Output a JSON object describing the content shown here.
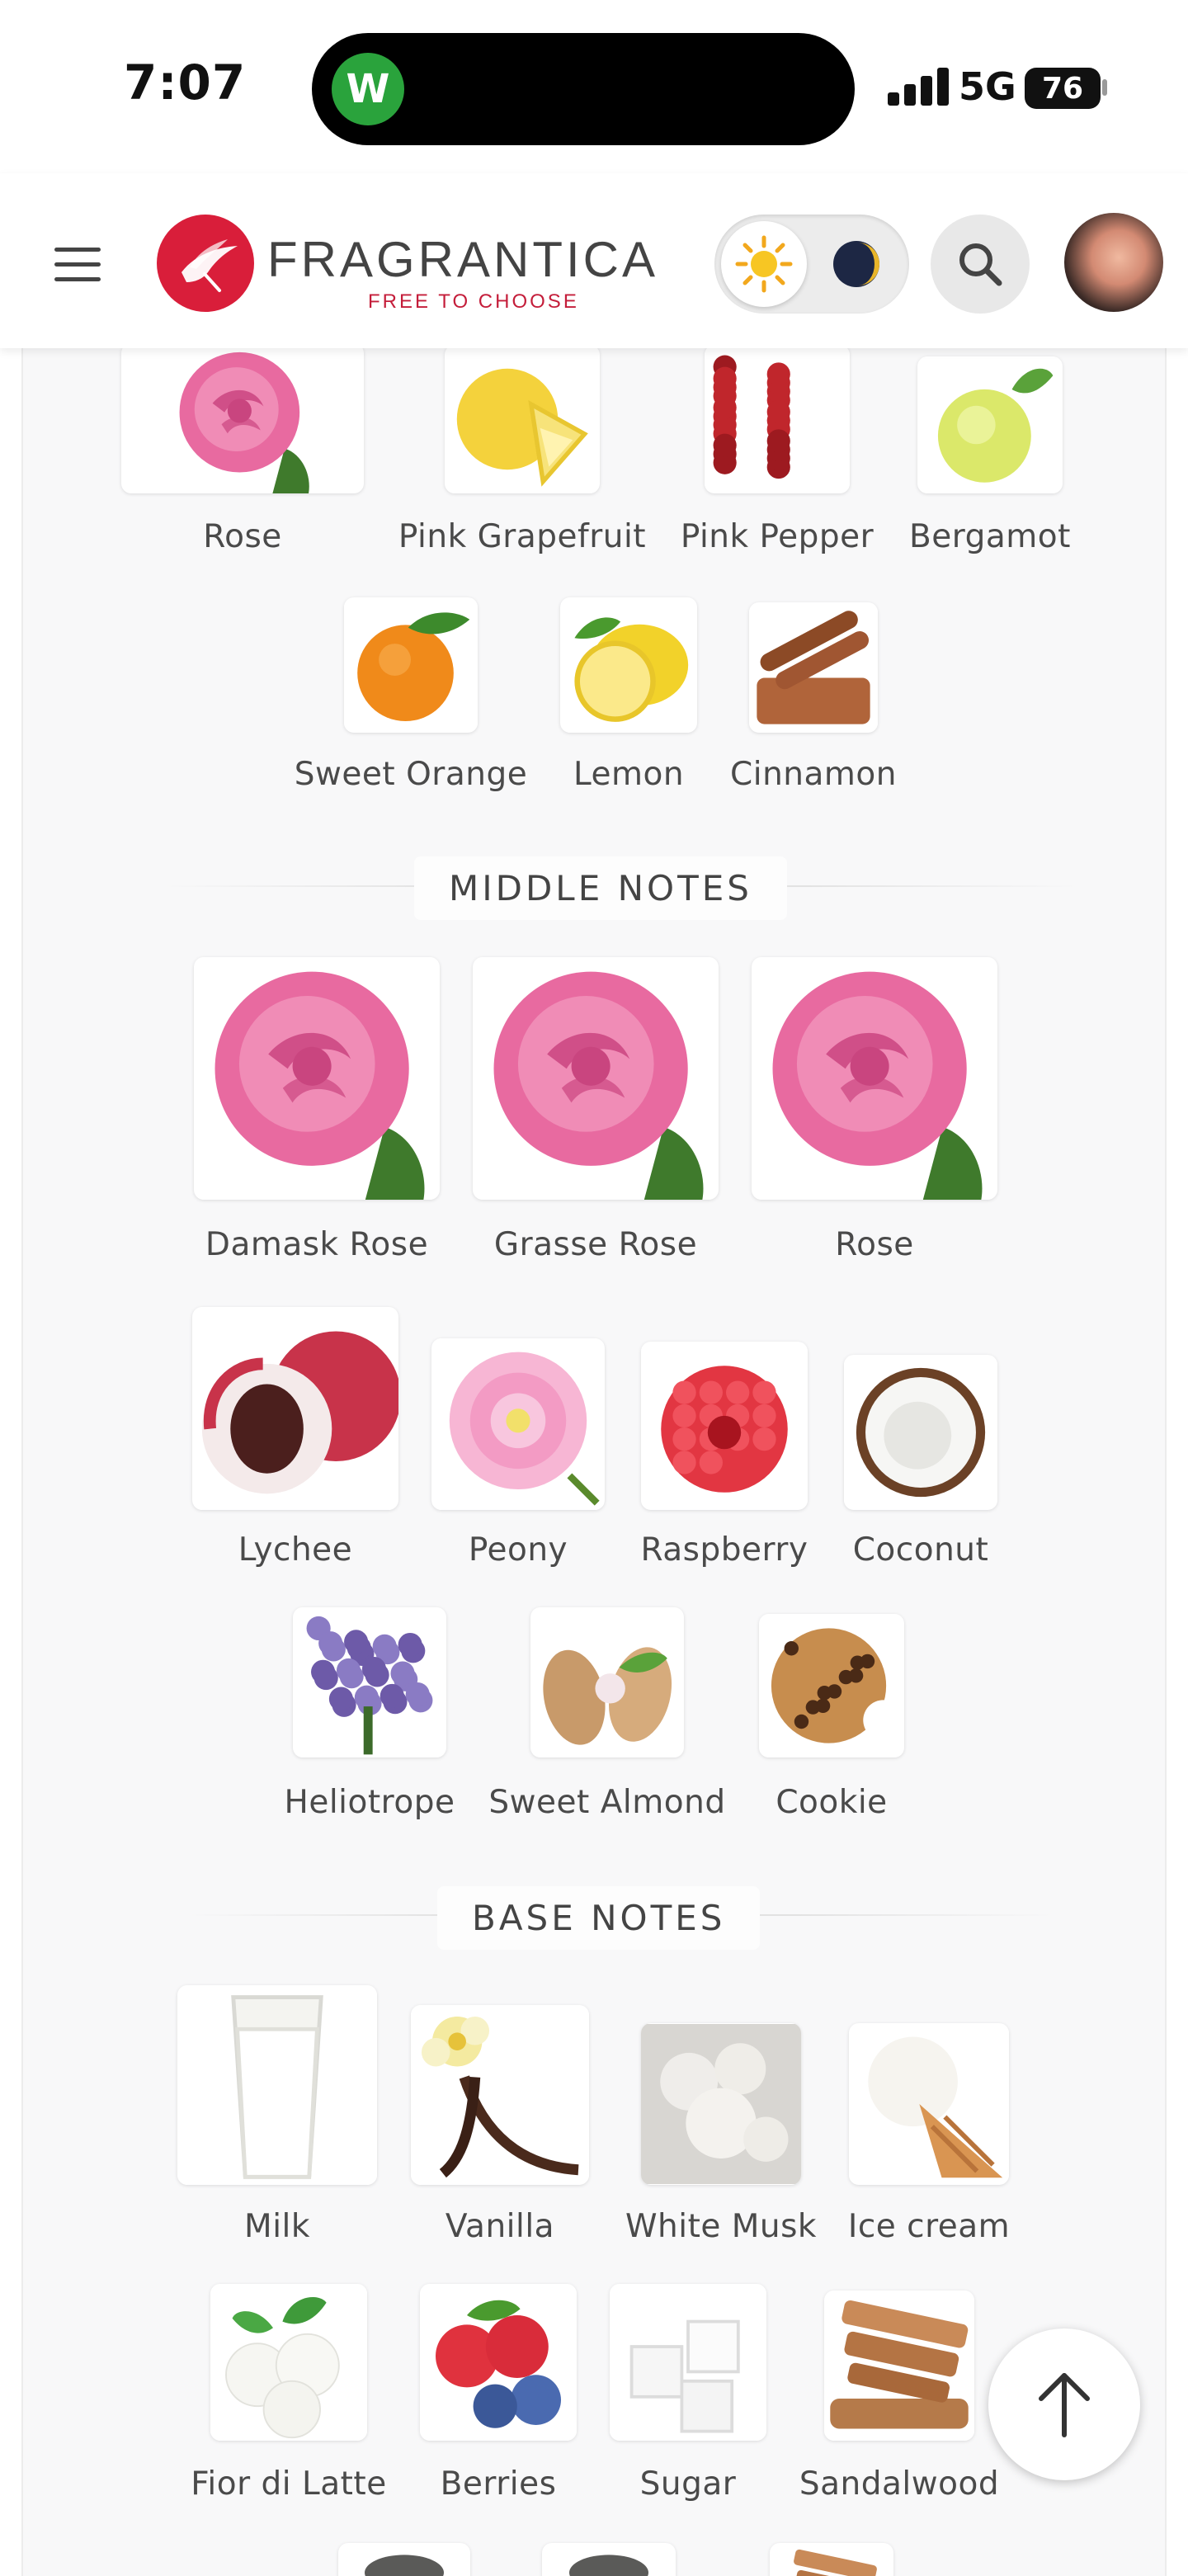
{
  "status_bar": {
    "time": "7:07",
    "network": "5G",
    "battery": "76",
    "island_app_glyph": "W"
  },
  "header": {
    "brand": "FRAGRANTICA",
    "tagline": "FREE TO CHOOSE",
    "icons": [
      "menu-icon",
      "hummingbird-logo",
      "sun-icon",
      "moon-icon",
      "search-icon",
      "user-avatar"
    ]
  },
  "sections": {
    "top_tail": {
      "notes": [
        "Rose",
        "Pink Grapefruit",
        "Pink Pepper",
        "Bergamot",
        "Sweet Orange",
        "Lemon",
        "Cinnamon"
      ]
    },
    "middle": {
      "title": "MIDDLE NOTES",
      "notes": [
        "Damask Rose",
        "Grasse Rose",
        "Rose",
        "Lychee",
        "Peony",
        "Raspberry",
        "Coconut",
        "Heliotrope",
        "Sweet Almond",
        "Cookie"
      ]
    },
    "base": {
      "title": "BASE NOTES",
      "notes": [
        "Milk",
        "Vanilla",
        "White Musk",
        "Ice cream",
        "Fior di Latte",
        "Berries",
        "Sugar",
        "Sandalwood"
      ]
    }
  },
  "colors": {
    "brand_red": "#d91e3a",
    "page_bg": "#f8f8f9",
    "label_text": "#4a4a4a"
  }
}
